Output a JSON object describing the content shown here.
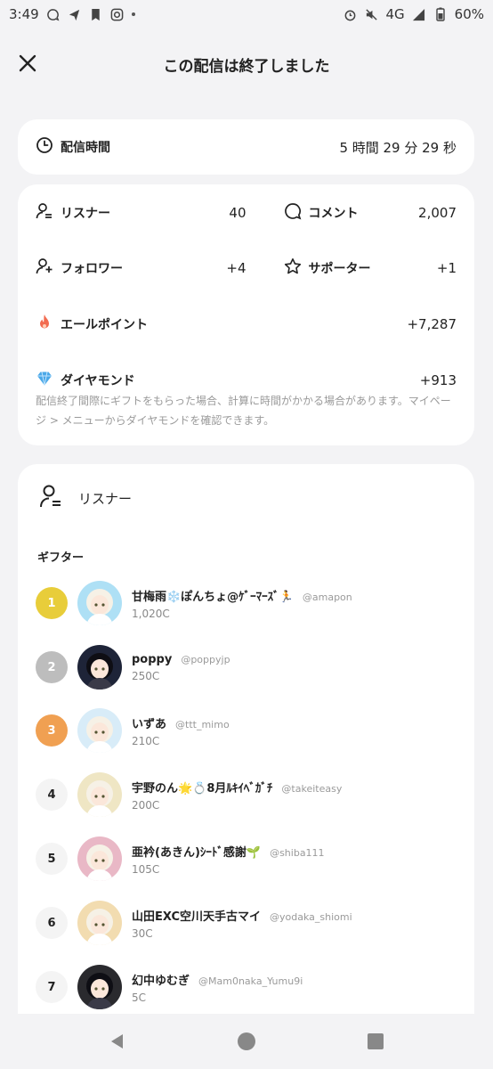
{
  "status_bar": {
    "time": "3:49",
    "network": "4G",
    "battery": "60%",
    "icons": [
      "chat-bubble-icon",
      "send-icon",
      "bookmark-icon",
      "instagram-icon",
      "alarm-icon",
      "mute-icon",
      "signal-icon",
      "battery-icon"
    ]
  },
  "header": {
    "title": "この配信は終了しました"
  },
  "summary": {
    "duration_label": "配信時間",
    "duration_value": "5 時間 29 分 29 秒"
  },
  "stats": {
    "listener_label": "リスナー",
    "listener_value": "40",
    "comment_label": "コメント",
    "comment_value": "2,007",
    "follower_label": "フォロワー",
    "follower_value": "+4",
    "supporter_label": "サポーター",
    "supporter_value": "+1",
    "yell_label": "エールポイント",
    "yell_value": "+7,287",
    "diamond_label": "ダイヤモンド",
    "diamond_value": "+913",
    "diamond_note": "配信終了間際にギフトをもらった場合、計算に時間がかかる場合があります。マイページ > メニューからダイヤモンドを確認できます。"
  },
  "listeners": {
    "section_title": "リスナー",
    "gifter_title": "ギフター",
    "gifters": [
      {
        "rank": "1",
        "name": "甘梅雨❄️ぽんちょ@ｹﾞｰﾏｰｽﾞ🏃",
        "handle": "@amapon",
        "amount": "1,020C",
        "avatar_color": "#aee0f5"
      },
      {
        "rank": "2",
        "name": "poppy",
        "handle": "@poppyjp",
        "amount": "250C",
        "avatar_color": "#1e2438"
      },
      {
        "rank": "3",
        "name": "いずあ",
        "handle": "@ttt_mimo",
        "amount": "210C",
        "avatar_color": "#d8ecf8"
      },
      {
        "rank": "4",
        "name": "宇野のん🌟💍8月ﾙｷｲﾍﾞｶﾞﾁ",
        "handle": "@takeiteasy",
        "amount": "200C",
        "avatar_color": "#efe6c4"
      },
      {
        "rank": "5",
        "name": "亜衿(あきん)ｼｰﾄﾞ感謝🌱",
        "handle": "@shiba111",
        "amount": "105C",
        "avatar_color": "#e9b8c6"
      },
      {
        "rank": "6",
        "name": "山田EXC空川天手古マイ",
        "handle": "@yodaka_shiomi",
        "amount": "30C",
        "avatar_color": "#f2dcb0"
      },
      {
        "rank": "7",
        "name": "幻中ゆむぎ",
        "handle": "@Mam0naka_Yumu9i",
        "amount": "5C",
        "avatar_color": "#2a2a2e"
      }
    ]
  },
  "colors": {
    "rank1": "#e8cd3a",
    "rank2": "#bdbdbd",
    "rank3": "#f0a052",
    "flame": "#f26b50",
    "diamond": "#4aa8e8"
  },
  "nav": {
    "icons": [
      "back-icon",
      "home-icon",
      "recents-icon"
    ]
  }
}
